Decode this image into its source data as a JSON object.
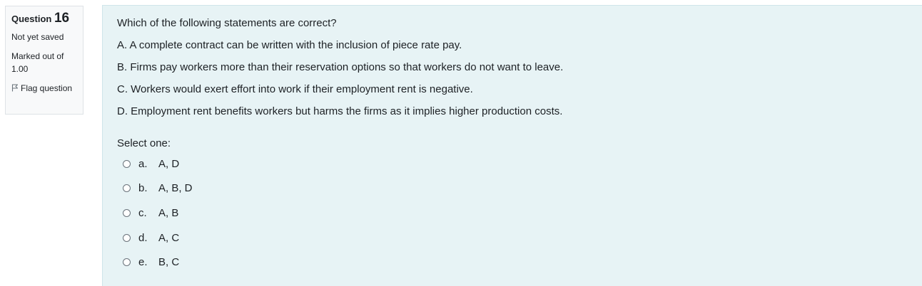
{
  "question_info": {
    "label": "Question",
    "number": "16",
    "state": "Not yet saved",
    "grade": "Marked out of 1.00",
    "flag_label": "Flag question",
    "flag_icon": "flag-icon"
  },
  "question": {
    "text": "Which of the following statements are correct?",
    "statements": [
      "A. A complete contract can be written with the inclusion of piece rate pay.",
      "B. Firms pay workers more than their reservation options so that workers do not want to leave.",
      "C. Workers would exert effort into work if their employment rent is negative.",
      "D. Employment rent benefits workers but harms the firms as it implies higher production costs."
    ],
    "prompt": "Select one:",
    "options": [
      {
        "letter": "a.",
        "text": "A, D"
      },
      {
        "letter": "b.",
        "text": "A, B, D"
      },
      {
        "letter": "c.",
        "text": "A, B"
      },
      {
        "letter": "d.",
        "text": "A, C"
      },
      {
        "letter": "e.",
        "text": "B, C"
      }
    ]
  },
  "colors": {
    "content_background": "#e7f3f5",
    "info_background": "#f8f9fa",
    "text": "#1d2125"
  }
}
